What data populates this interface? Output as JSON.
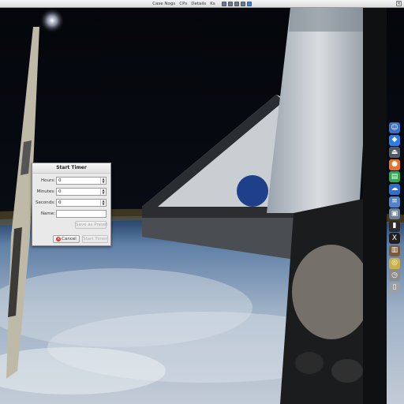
{
  "menubar": {
    "items": [
      "Case Nogs",
      "CPs",
      "Details",
      "Ks"
    ],
    "tray_icons": [
      "tray-icon-1",
      "tray-icon-2",
      "tray-icon-3",
      "tray-icon-4",
      "tray-icon-5"
    ],
    "close_glyph": "×"
  },
  "dialog": {
    "title": "Start Timer",
    "hours": {
      "label": "Hours:",
      "value": "0"
    },
    "minutes": {
      "label": "Minutes:",
      "value": "0"
    },
    "seconds": {
      "label": "Seconds:",
      "value": "0"
    },
    "name": {
      "label": "Name:",
      "value": ""
    },
    "save_preset_label": "Save as Preset",
    "cancel_label": "Cancel",
    "start_label": "Start Timer"
  },
  "dock": {
    "items": [
      {
        "name": "finder-icon",
        "glyph": "☺",
        "color": "#3b6fc4"
      },
      {
        "name": "dropbox-icon",
        "glyph": "◆",
        "color": "#2c7fe0"
      },
      {
        "name": "eject-icon",
        "glyph": "⏏",
        "color": "#505a66"
      },
      {
        "name": "firefox-icon",
        "glyph": "●",
        "color": "#e8722a"
      },
      {
        "name": "document-icon",
        "glyph": "▤",
        "color": "#2fa84f"
      },
      {
        "name": "onedrive-icon",
        "glyph": "☁",
        "color": "#2d6ed0"
      },
      {
        "name": "text-file-icon",
        "glyph": "≡",
        "color": "#4f84c6"
      },
      {
        "name": "photo-icon",
        "glyph": "▣",
        "color": "#6d7f94"
      },
      {
        "name": "terminal-icon",
        "glyph": "▮",
        "color": "#2b2b2b"
      },
      {
        "name": "x11-icon",
        "glyph": "X",
        "color": "#1f1f1f"
      },
      {
        "name": "books-icon",
        "glyph": "▥",
        "color": "#7a5a3a"
      },
      {
        "name": "disk-icon",
        "glyph": "◎",
        "color": "#c8b04a"
      },
      {
        "name": "timer-icon",
        "glyph": "◷",
        "color": "#8c8c8c"
      },
      {
        "name": "trash-icon",
        "glyph": "▯",
        "color": "#9aa0a6"
      }
    ]
  }
}
